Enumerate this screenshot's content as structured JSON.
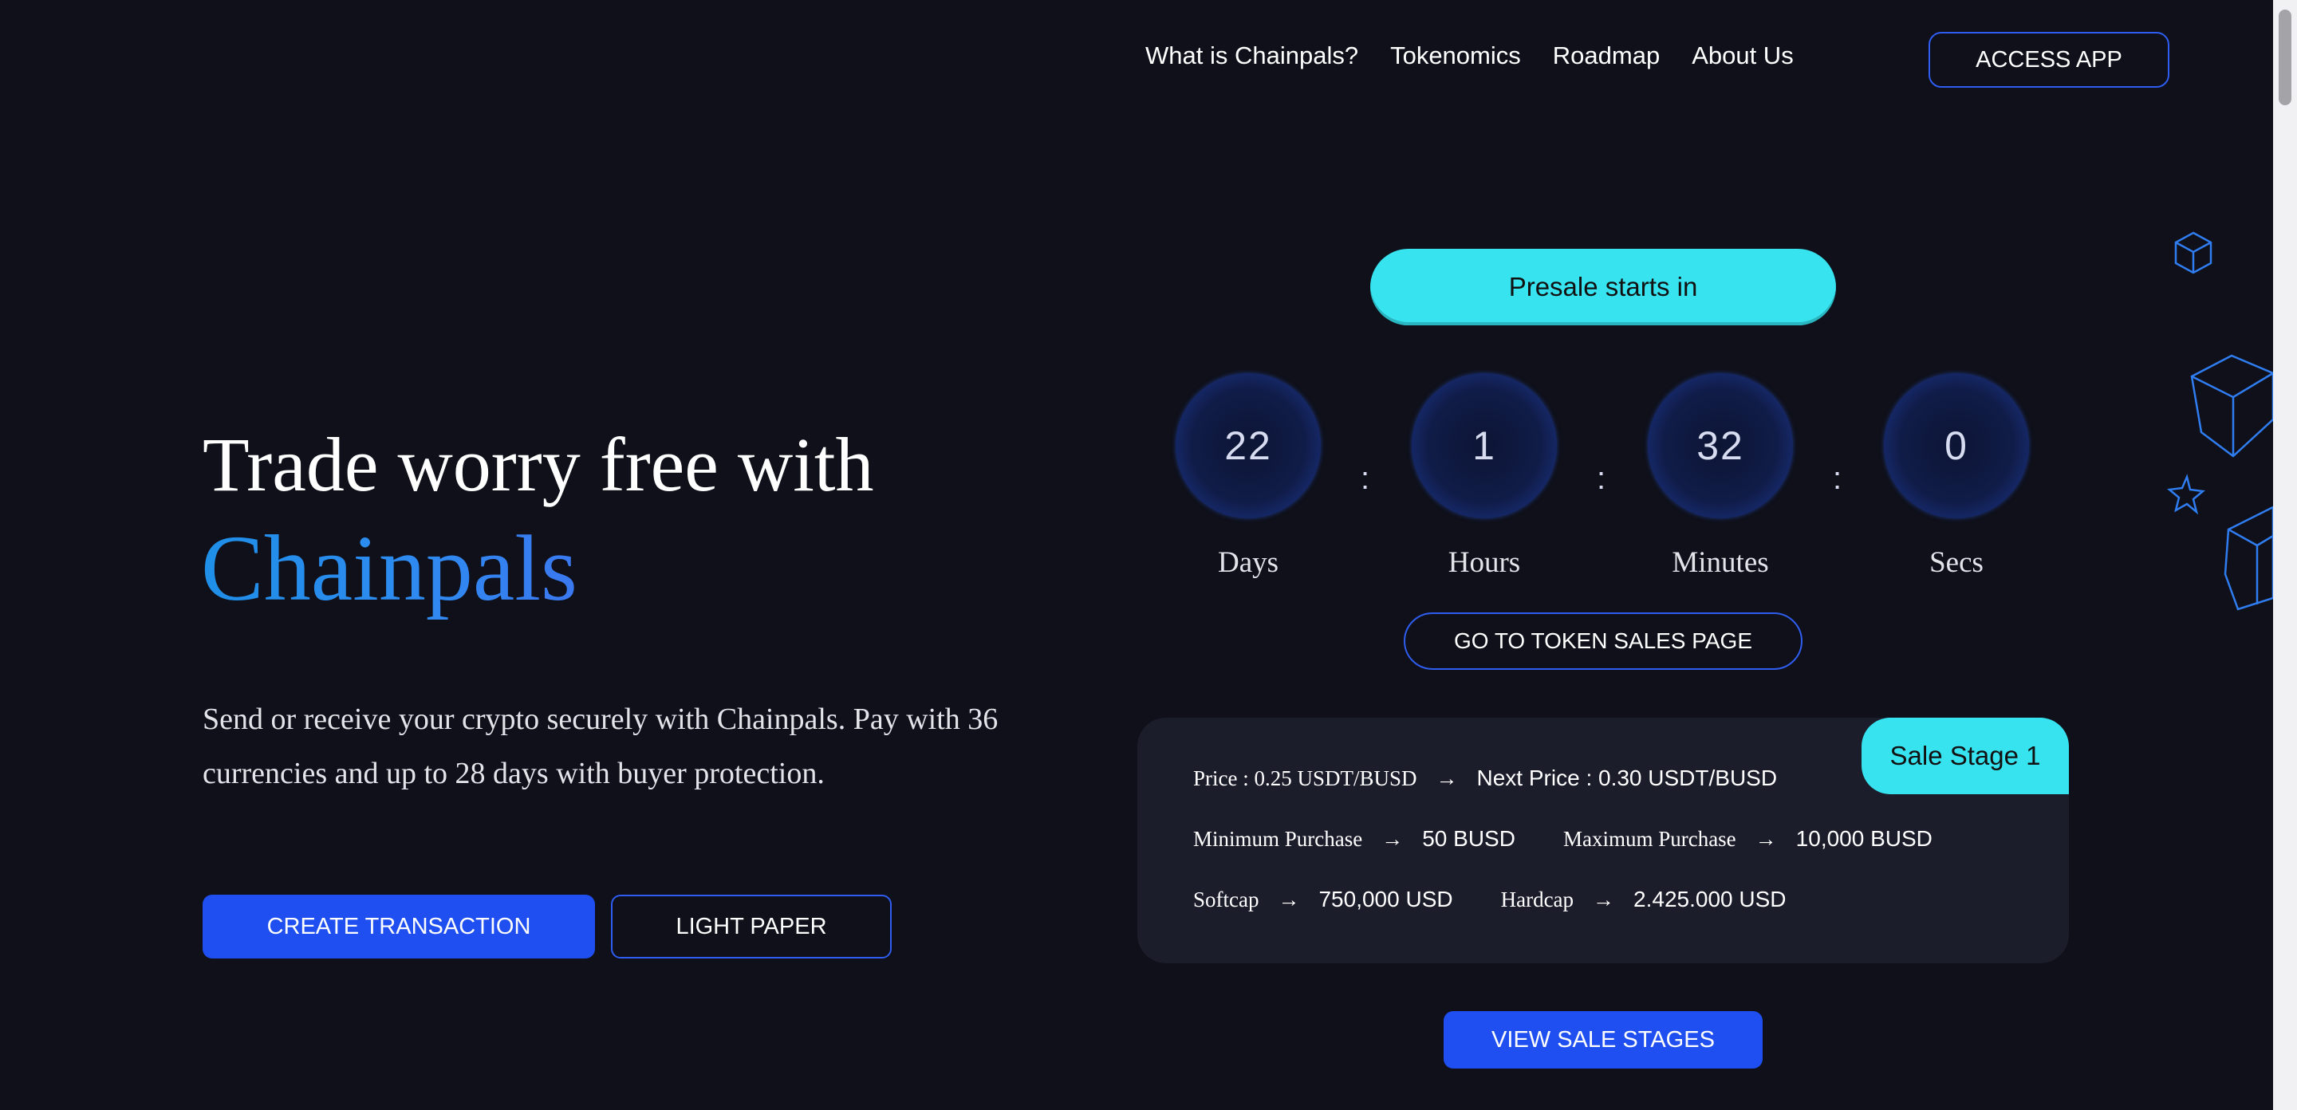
{
  "nav": {
    "links": [
      "What is Chainpals?",
      "Tokenomics",
      "Roadmap",
      "About Us"
    ],
    "access_label": "ACCESS APP"
  },
  "hero": {
    "title": "Trade worry free with",
    "brand": "Chainpals",
    "description": "Send or receive your crypto securely with Chainpals. Pay with 36 currencies and up to 28 days with buyer protection.",
    "create_label": "CREATE TRANSACTION",
    "lightpaper_label": "LIGHT PAPER"
  },
  "presale": {
    "pill_label": "Presale starts in",
    "countdown": [
      {
        "value": "22",
        "label": "Days"
      },
      {
        "value": "1",
        "label": "Hours"
      },
      {
        "value": "32",
        "label": "Minutes"
      },
      {
        "value": "0",
        "label": "Secs"
      }
    ],
    "separator": ":",
    "token_sales_label": "GO TO TOKEN SALES PAGE"
  },
  "sale": {
    "stage": "Sale Stage 1",
    "arrow": "→",
    "price_label": "Price : 0.25 USDT/BUSD",
    "next_price": "Next Price : 0.30 USDT/BUSD",
    "min_label": "Minimum Purchase",
    "min_value": "50 BUSD",
    "max_label": "Maximum Purchase",
    "max_value": "10,000 BUSD",
    "softcap_label": "Softcap",
    "softcap_value": "750,000 USD",
    "hardcap_label": "Hardcap",
    "hardcap_value": "2.425.000 USD",
    "view_stages_label": "VIEW SALE STAGES"
  },
  "colors": {
    "background": "#0f1019",
    "accent_blue": "#1f4ff0",
    "accent_cyan": "#37e3ef",
    "card": "#1b1d2b"
  },
  "icons": [
    "cube-outline-icon",
    "star-outline-icon"
  ]
}
